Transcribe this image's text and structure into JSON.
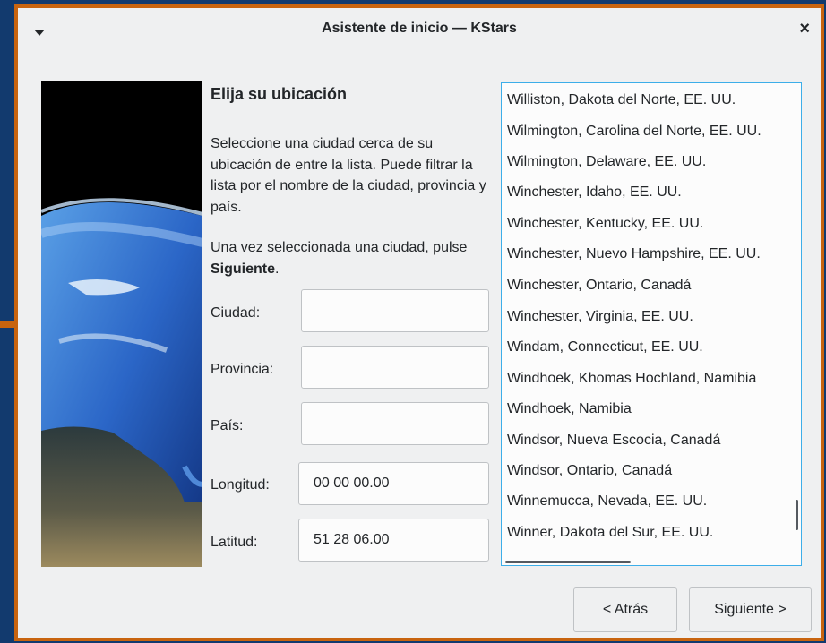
{
  "window": {
    "title": "Asistente de inicio — KStars",
    "close_glyph": "×"
  },
  "page": {
    "heading": "Elija su ubicación",
    "intro": "Seleccione una ciudad cerca de su ubicación de entre la lista. Puede filtrar la lista por el nombre de la ciudad, provincia y país.",
    "instruction_prefix": "Una vez seleccionada una ciudad, pulse ",
    "instruction_bold": "Siguiente",
    "instruction_suffix": "."
  },
  "form": {
    "city_label": "Ciudad:",
    "city_value": "",
    "province_label": "Provincia:",
    "province_value": "",
    "country_label": "País:",
    "country_value": "",
    "longitude_label": "Longitud:",
    "longitude_value": "00 00 00.00",
    "latitude_label": "Latitud:",
    "latitude_value": "51 28 06.00"
  },
  "city_list": [
    "Williston, Dakota del Norte, EE. UU.",
    "Wilmington, Carolina del Norte, EE. UU.",
    "Wilmington, Delaware, EE. UU.",
    "Winchester, Idaho, EE. UU.",
    "Winchester, Kentucky, EE. UU.",
    "Winchester, Nuevo Hampshire, EE. UU.",
    "Winchester, Ontario, Canadá",
    "Winchester, Virginia, EE. UU.",
    "Windam, Connecticut, EE. UU.",
    "Windhoek, Khomas Hochland, Namibia",
    "Windhoek, Namibia",
    "Windsor, Nueva Escocia, Canadá",
    "Windsor, Ontario, Canadá",
    "Winnemucca, Nevada, EE. UU.",
    "Winner, Dakota del Sur, EE. UU."
  ],
  "buttons": {
    "back": "< Atrás",
    "next": "Siguiente >"
  },
  "colors": {
    "accent": "#3daee9",
    "window_border": "#c8640f",
    "desktop": "#123a6e"
  }
}
